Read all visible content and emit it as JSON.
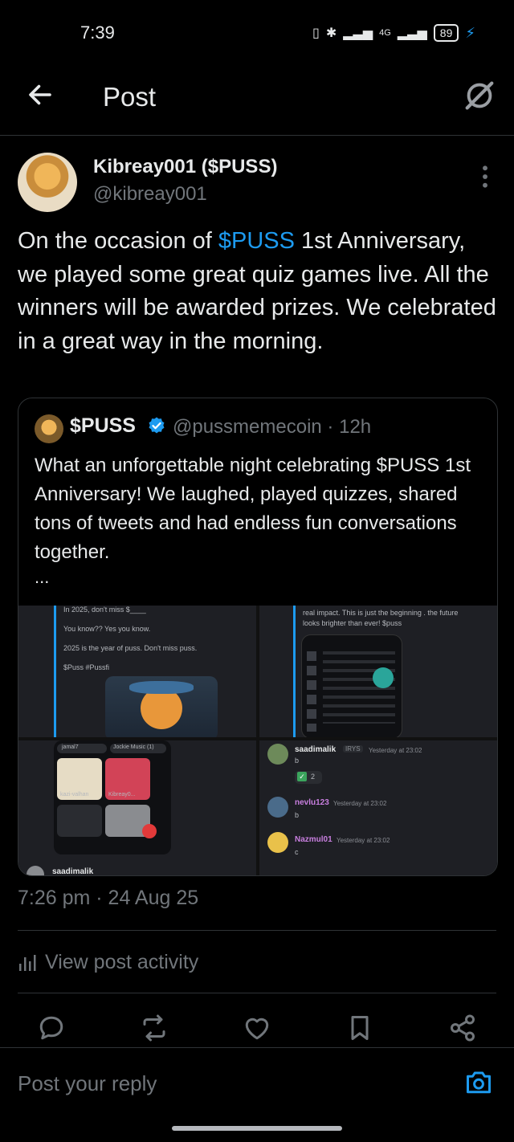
{
  "status_bar": {
    "time": "7:39",
    "network": "4G",
    "battery": "89"
  },
  "header": {
    "title": "Post"
  },
  "post": {
    "author_name": "Kibreay001 ($PUSS)",
    "author_handle": "@kibreay001",
    "text_part1": "On the occasion of ",
    "text_link": "$PUSS",
    "text_part2": " 1st Anniversary, we played some great quiz games live. All the winners will be awarded prizes. We celebrated in a great way in the morning.",
    "timestamp": "7:26 pm · 24 Aug 25"
  },
  "quote": {
    "name": "$PUSS",
    "handle_time": "@pussmemecoin · 12h",
    "text": "What an unforgettable night celebrating $PUSS 1st Anniversary!  We laughed, played quizzes, shared tons of tweets and had endless fun conversations together.",
    "ellipsis": "...",
    "media": {
      "tile1_lines": [
        "In 2025, don't miss $____",
        "You know?? Yes you know.",
        "2025 is the year of puss. Don't miss puss.",
        "$Puss #Pussfi"
      ],
      "tile2_lines": [
        "real impact. This is just the beginning . the future",
        "looks brighter than ever! $puss"
      ],
      "tile3_labels": [
        "jamal7",
        "Jockie Music (1)",
        "kazi-valhan",
        "Kibreay0..."
      ],
      "tile3_footer": "saadimalik",
      "tile4_messages": [
        {
          "name": "saadimalik",
          "badge": "IRYS",
          "time": "Yesterday at 23:02",
          "body": "b"
        },
        {
          "name": "nevlu123",
          "badge": "",
          "time": "Yesterday at 23:02",
          "body": "b"
        },
        {
          "name": "Nazmul01",
          "badge": "",
          "time": "Yesterday at 23:02",
          "body": "c"
        }
      ],
      "tile4_reaction": "2"
    }
  },
  "activity": {
    "label": "View post activity"
  },
  "reply": {
    "placeholder": "Post your reply"
  },
  "colors": {
    "background": "#000000",
    "accent": "#1d9bf0",
    "muted": "#71767b",
    "text": "#e7e9ea",
    "divider": "#2f3336"
  }
}
